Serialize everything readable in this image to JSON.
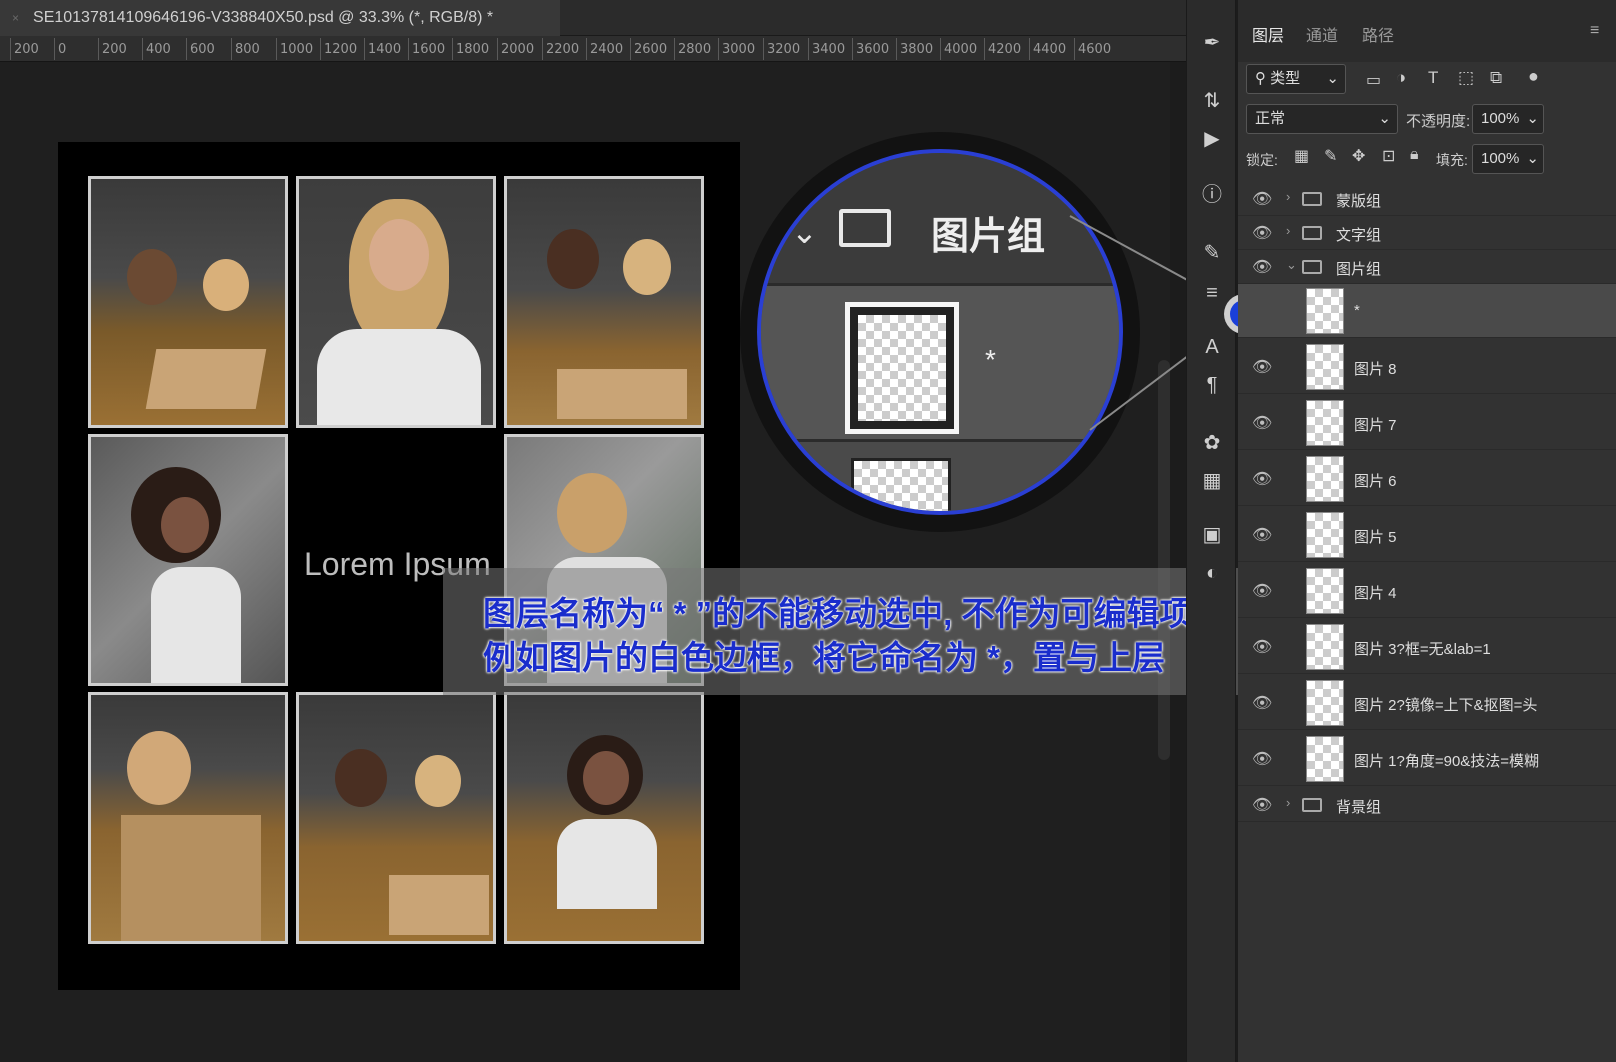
{
  "document": {
    "tab_title": "SE10137814109646196-V338840X50.psd @ 33.3% (*, RGB/8) *",
    "close_glyph": "×"
  },
  "ruler": {
    "ticks": [
      "200",
      "0",
      "200",
      "400",
      "600",
      "800",
      "1000",
      "1200",
      "1400",
      "1600",
      "1800",
      "2000",
      "2200",
      "2400",
      "2600",
      "2800",
      "3000",
      "3200",
      "3400",
      "3600",
      "3800",
      "4000",
      "4200",
      "4400",
      "4600"
    ]
  },
  "canvas": {
    "lorem_text": "Lorem Ipsum",
    "annotation_line1": "图层名称为“ * ”的不能移动选中, 不作为可编辑项",
    "annotation_line2": "例如图片的白色边框，将它命名为 *，置与上层"
  },
  "magnifier": {
    "folder_name": "图片组",
    "layer_name": "*"
  },
  "panel": {
    "tabs": [
      "图层",
      "通道",
      "路径"
    ],
    "filter_label": "类型",
    "blend_mode": "正常",
    "opacity_label": "不透明度:",
    "opacity_value": "100%",
    "lock_label": "锁定:",
    "fill_label": "填充:",
    "fill_value": "100%"
  },
  "layers": [
    {
      "name": "蒙版组",
      "type": "group",
      "expanded": false
    },
    {
      "name": "文字组",
      "type": "group",
      "expanded": false
    },
    {
      "name": "图片组",
      "type": "group",
      "expanded": true
    },
    {
      "name": "*",
      "type": "layer",
      "selected": true
    },
    {
      "name": "图片 8",
      "type": "layer"
    },
    {
      "name": "图片 7",
      "type": "layer"
    },
    {
      "name": "图片 6",
      "type": "layer"
    },
    {
      "name": "图片 5",
      "type": "layer"
    },
    {
      "name": "图片 4",
      "type": "layer"
    },
    {
      "name": "图片 3?框=无&lab=1",
      "type": "layer"
    },
    {
      "name": "图片 2?镜像=上下&抠图=头",
      "type": "layer"
    },
    {
      "name": "图片 1?角度=90&技法=模糊",
      "type": "layer"
    },
    {
      "name": "背景组",
      "type": "group",
      "expanded": false
    }
  ],
  "icons": {
    "eye": "eye-icon",
    "folder": "folder-icon",
    "pen": "pen-tool-icon",
    "play": "play-icon",
    "info": "info-icon",
    "brush": "brush-icon",
    "type": "type-icon",
    "paragraph": "paragraph-icon",
    "palette": "palette-icon",
    "table": "table-icon"
  },
  "colors": {
    "accent": "#1a2dcc",
    "magnifier_border": "#2a3fd4",
    "indicator_dot": "#1a3fd8"
  }
}
